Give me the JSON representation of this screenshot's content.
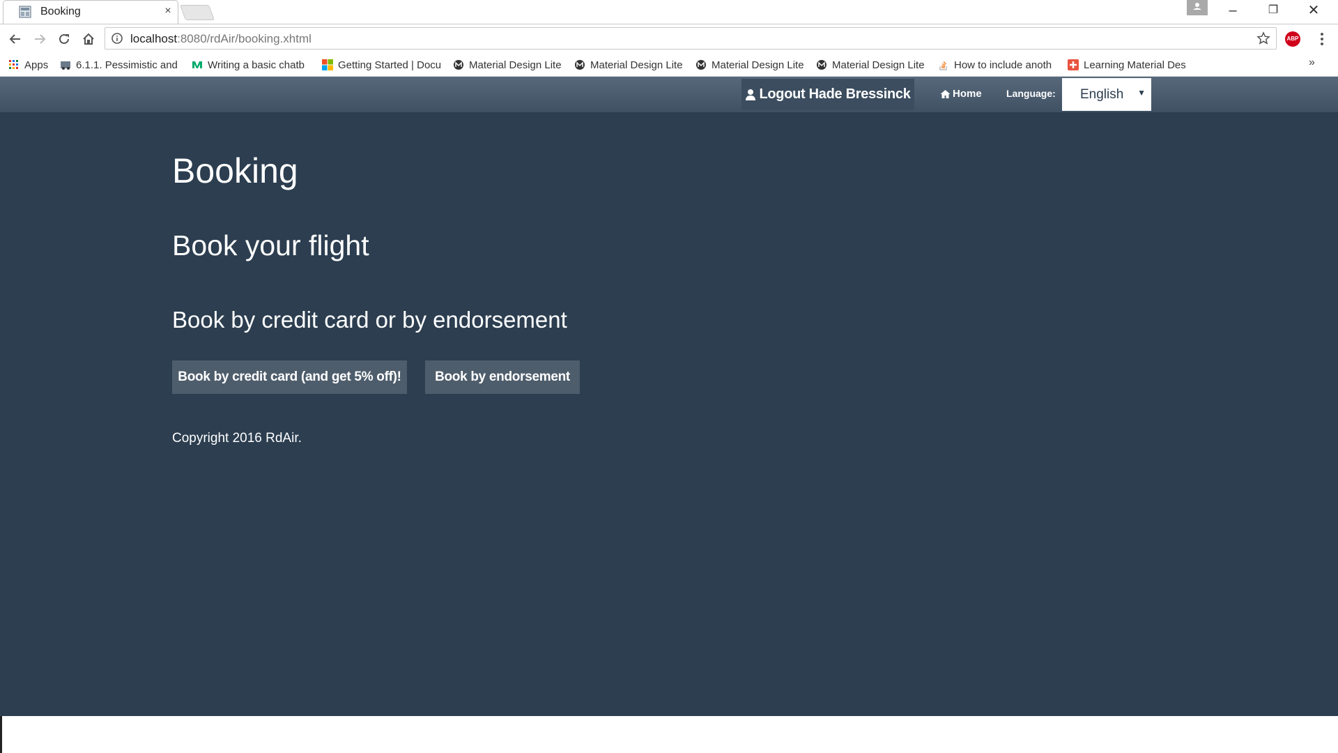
{
  "browser": {
    "tab": {
      "title": "Booking",
      "close": "×"
    },
    "window_controls": {
      "minimize": "–",
      "restore": "❐",
      "close": "✕"
    },
    "address": {
      "host": "localhost",
      "rest": ":8080/rdAir/booking.xhtml"
    },
    "extension": "ABP",
    "bookmarks": [
      {
        "label": "Apps",
        "icon": "apps-grid-icon"
      },
      {
        "label": "6.1.1. Pessimistic and",
        "icon": "jboss-icon"
      },
      {
        "label": "Writing a basic chatb",
        "icon": "medium-icon"
      },
      {
        "label": "Getting Started | Docu",
        "icon": "microsoft-icon"
      },
      {
        "label": "Material Design Lite",
        "icon": "mdl-icon"
      },
      {
        "label": "Material Design Lite",
        "icon": "mdl-icon"
      },
      {
        "label": "Material Design Lite",
        "icon": "mdl-icon"
      },
      {
        "label": "Material Design Lite",
        "icon": "mdl-icon"
      },
      {
        "label": "How to include anoth",
        "icon": "stackoverflow-icon"
      },
      {
        "label": "Learning Material Des",
        "icon": "learning-icon"
      }
    ],
    "bookmarks_overflow": "»"
  },
  "navbar": {
    "logout": "Logout Hade Bressinck",
    "home": "Home",
    "language_label": "Language:",
    "language_value": "English"
  },
  "content": {
    "title": "Booking",
    "subtitle": "Book your flight",
    "section": "Book by credit card or by endorsement",
    "credit_card_button": "Book by credit card (and get 5% off)!",
    "endorsement_button": "Book by endorsement",
    "copyright": "Copyright 2016 RdAir."
  },
  "colors": {
    "page_background": "#2c3e50",
    "navbar": "#4a5b6d",
    "button": "#4e5d6c"
  }
}
